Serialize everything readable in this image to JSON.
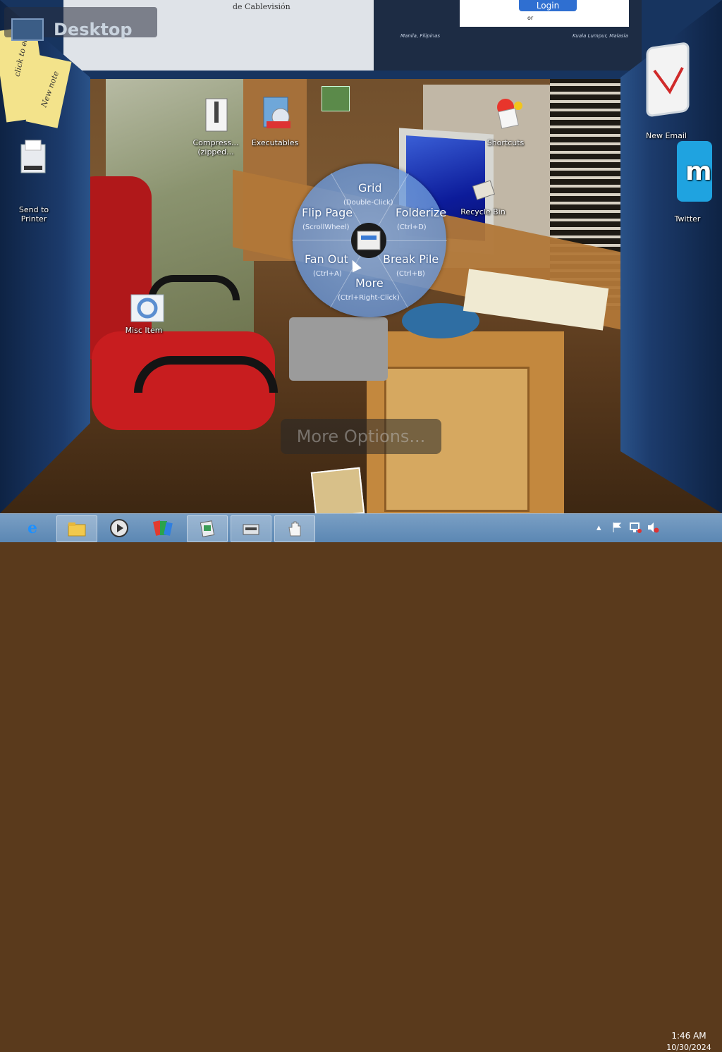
{
  "desktop_label": "Desktop",
  "top_panels": {
    "cablevision_text": "de Cablevisión",
    "login_label": "Login",
    "login_or": "or",
    "city1": "Manila, Filipinas",
    "city2": "Kuala Lumpur, Malasia"
  },
  "sticky_notes": {
    "note1": "click to edit",
    "note2": "New note"
  },
  "desktop_icons": [
    {
      "label": "Compress... (zipped..."
    },
    {
      "label": "Executables"
    },
    {
      "label": "Shortcuts"
    },
    {
      "label": "Recycle Bin"
    },
    {
      "label": "Misc Item"
    }
  ],
  "side_icons": {
    "send_to_printer": "Send to Printer",
    "new_email": "New Email",
    "twitter": "Twitter"
  },
  "radial_menu": {
    "grid": {
      "label": "Grid",
      "hint": "(Double-Click)"
    },
    "flip_page": {
      "label": "Flip Page",
      "hint": "(ScrollWheel)"
    },
    "folderize": {
      "label": "Folderize",
      "hint": "(Ctrl+D)"
    },
    "fan_out": {
      "label": "Fan Out",
      "hint": "(Ctrl+A)"
    },
    "break_pile": {
      "label": "Break Pile",
      "hint": "(Ctrl+B)"
    },
    "more": {
      "label": "More",
      "hint": "(Ctrl+Right-Click)"
    }
  },
  "more_options": "More Options...",
  "taskbar": {
    "clock_time": "1:46 AM",
    "clock_date": "10/30/2024",
    "apps": [
      {
        "name": "internet-explorer-icon"
      },
      {
        "name": "file-explorer-icon"
      },
      {
        "name": "media-player-icon"
      },
      {
        "name": "bumptop-icon"
      },
      {
        "name": "pile-app-icon"
      },
      {
        "name": "scanner-icon"
      },
      {
        "name": "hand-icon"
      }
    ]
  },
  "colors": {
    "taskbar": "#5b87b3",
    "radial": "#7aa2e0",
    "frame": "#17345f"
  }
}
